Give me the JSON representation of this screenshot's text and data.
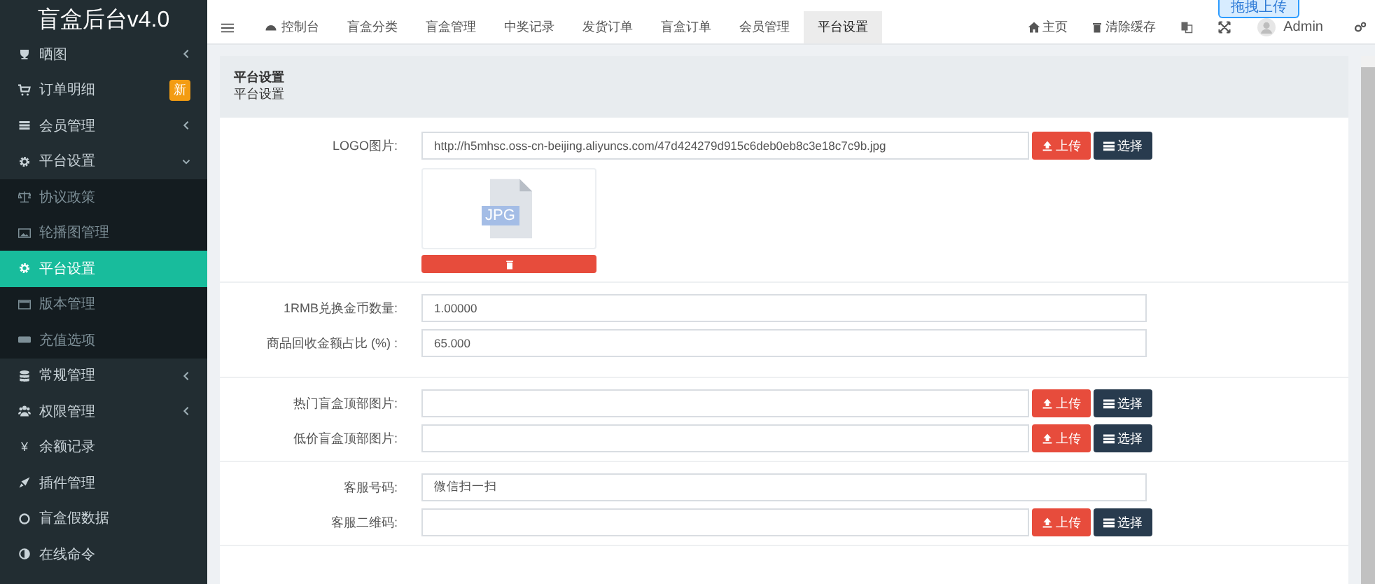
{
  "app_title": "盲盒后台v4.0",
  "upload_badge": "拖拽上传",
  "top_nav": {
    "tabs": [
      {
        "label": "控制台",
        "selected": false
      },
      {
        "label": "盲盒分类",
        "selected": false
      },
      {
        "label": "盲盒管理",
        "selected": false
      },
      {
        "label": "中奖记录",
        "selected": false
      },
      {
        "label": "发货订单",
        "selected": false
      },
      {
        "label": "盲盒订单",
        "selected": false
      },
      {
        "label": "会员管理",
        "selected": false
      },
      {
        "label": "平台设置",
        "selected": true
      }
    ],
    "links": [
      {
        "label": "主页"
      },
      {
        "label": "清除缓存"
      }
    ],
    "user": "Admin"
  },
  "sidebar": {
    "items": [
      {
        "label": "晒图",
        "expanded": false
      },
      {
        "label": "订单明细",
        "badge": "新"
      },
      {
        "label": "会员管理",
        "expanded": false
      },
      {
        "label": "平台设置",
        "expanded": true,
        "children": [
          {
            "label": "协议政策",
            "selected": false
          },
          {
            "label": "轮播图管理",
            "selected": false
          },
          {
            "label": "平台设置",
            "selected": true
          },
          {
            "label": "版本管理",
            "selected": false
          },
          {
            "label": "充值选项",
            "selected": false
          }
        ]
      },
      {
        "label": "常规管理",
        "expanded": false
      },
      {
        "label": "权限管理",
        "expanded": false
      },
      {
        "label": "余额记录",
        "icon_char": "¥"
      },
      {
        "label": "插件管理"
      },
      {
        "label": "盲盒假数据"
      },
      {
        "label": "在线命令"
      }
    ]
  },
  "panel": {
    "title": "平台设置",
    "subtitle": "平台设置"
  },
  "form": {
    "sections": [
      {
        "rows": [
          {
            "kind": "upload",
            "label": "LOGO图片:",
            "value": "http://h5mhsc.oss-cn-beijing.aliyuncs.com/47d424279d915c6deb0eb8c3e18c7c9b.jpg",
            "upload": "上传",
            "choose": "选择",
            "preview": "JPG"
          }
        ]
      },
      {
        "rows": [
          {
            "kind": "text",
            "label": "1RMB兑换金币数量:",
            "value": "1.00000"
          },
          {
            "kind": "text",
            "label": "商品回收金额占比 (%) :",
            "value": "65.000"
          }
        ]
      },
      {
        "rows": [
          {
            "kind": "upload",
            "label": "热门盲盒顶部图片:",
            "value": "",
            "upload": "上传",
            "choose": "选择"
          },
          {
            "kind": "upload",
            "label": "低价盲盒顶部图片:",
            "value": "",
            "upload": "上传",
            "choose": "选择"
          }
        ]
      },
      {
        "rows": [
          {
            "kind": "text",
            "label": "客服号码:",
            "value": "微信扫一扫"
          },
          {
            "kind": "upload",
            "label": "客服二维码:",
            "value": "",
            "upload": "上传",
            "choose": "选择"
          }
        ]
      }
    ]
  }
}
